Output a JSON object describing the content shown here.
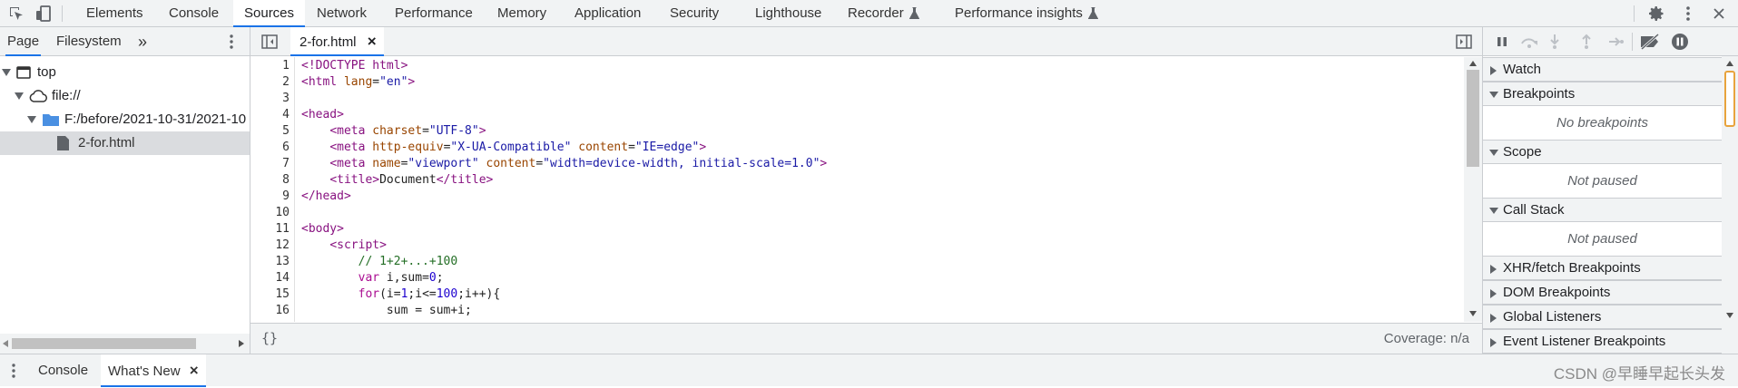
{
  "top_tabs": [
    "Elements",
    "Console",
    "Sources",
    "Network",
    "Performance",
    "Memory",
    "Application",
    "Security",
    "Lighthouse",
    "Recorder",
    "Performance insights"
  ],
  "active_top_tab": "Sources",
  "navigator": {
    "tabs": [
      "Page",
      "Filesystem"
    ],
    "more": "»",
    "tree": {
      "top": "top",
      "origin": "file://",
      "folder": "F:/before/2021-10-31/2021-10",
      "file": "2-for.html"
    }
  },
  "editor": {
    "tab_label": "2-for.html",
    "close_glyph": "×",
    "line_numbers": [
      "1",
      "2",
      "3",
      "4",
      "5",
      "6",
      "7",
      "8",
      "9",
      "10",
      "11",
      "12",
      "13",
      "14",
      "15",
      "16"
    ],
    "lines": [
      "<!DOCTYPE html>",
      "<html lang=\"en\">",
      "",
      "<head>",
      "    <meta charset=\"UTF-8\">",
      "    <meta http-equiv=\"X-UA-Compatible\" content=\"IE=edge\">",
      "    <meta name=\"viewport\" content=\"width=device-width, initial-scale=1.0\">",
      "    <title>Document</title>",
      "</head>",
      "",
      "<body>",
      "    <script>",
      "        // 1+2+...+100",
      "        var i,sum=0;",
      "        for(i=1;i<=100;i++){",
      "            sum = sum+i;"
    ],
    "format_button": "{}",
    "coverage": "Coverage: n/a"
  },
  "debugger": {
    "sections": {
      "watch": "Watch",
      "breakpoints": "Breakpoints",
      "no_breakpoints": "No breakpoints",
      "scope": "Scope",
      "scope_status": "Not paused",
      "call_stack": "Call Stack",
      "call_stack_status": "Not paused",
      "xhr": "XHR/fetch Breakpoints",
      "dom": "DOM Breakpoints",
      "global": "Global Listeners",
      "event": "Event Listener Breakpoints"
    }
  },
  "drawer": {
    "tabs": [
      "Console",
      "What's New"
    ],
    "close_glyph": "×"
  },
  "watermark": "CSDN @早睡早起长头发",
  "colors": {
    "accent": "#1a73e8",
    "tag": "#881280",
    "attr": "#994500",
    "value": "#1a1aa6",
    "comment": "#236e25",
    "keyword": "#aa0d91",
    "number": "#1c00cf"
  }
}
